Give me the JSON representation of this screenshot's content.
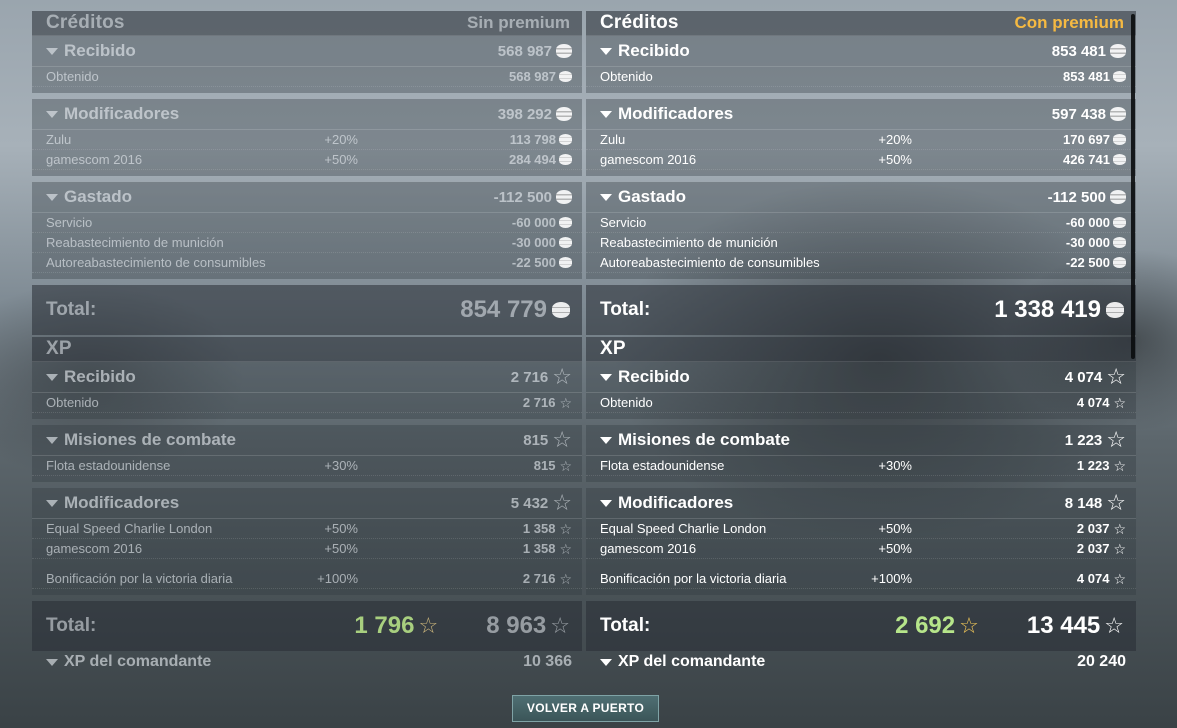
{
  "left": {
    "credits": {
      "title": "Créditos",
      "premium_label": "Sin premium",
      "received": {
        "label": "Recibido",
        "value": "568 987",
        "rows": [
          {
            "label": "Obtenido",
            "value": "568 987"
          }
        ]
      },
      "modifiers": {
        "label": "Modificadores",
        "value": "398 292",
        "rows": [
          {
            "label": "Zulu",
            "pct": "+20%",
            "value": "113 798"
          },
          {
            "label": "gamescom 2016",
            "pct": "+50%",
            "value": "284 494"
          }
        ]
      },
      "spent": {
        "label": "Gastado",
        "value": "-112 500",
        "rows": [
          {
            "label": "Servicio",
            "value": "-60 000"
          },
          {
            "label": "Reabastecimiento de munición",
            "value": "-30 000"
          },
          {
            "label": "Autoreabastecimiento de consumibles",
            "value": "-22 500"
          }
        ]
      },
      "total_label": "Total:",
      "total": "854 779"
    },
    "xp": {
      "title": "XP",
      "received": {
        "label": "Recibido",
        "value": "2 716",
        "rows": [
          {
            "label": "Obtenido",
            "value": "2 716"
          }
        ]
      },
      "missions": {
        "label": "Misiones de combate",
        "value": "815",
        "rows": [
          {
            "label": "Flota estadounidense",
            "pct": "+30%",
            "value": "815"
          }
        ]
      },
      "modifiers": {
        "label": "Modificadores",
        "value": "5 432",
        "rows": [
          {
            "label": "Equal Speed Charlie London",
            "pct": "+50%",
            "value": "1 358"
          },
          {
            "label": "gamescom 2016",
            "pct": "+50%",
            "value": "1 358"
          }
        ],
        "bonus": {
          "label": "Bonificación por la victoria diaria",
          "pct": "+100%",
          "value": "2 716"
        }
      },
      "total_label": "Total:",
      "total_free": "1 796",
      "total": "8 963"
    },
    "cut": {
      "label": "XP del comandante",
      "value": "10 366"
    }
  },
  "right": {
    "credits": {
      "title": "Créditos",
      "premium_label": "Con premium",
      "received": {
        "label": "Recibido",
        "value": "853 481",
        "rows": [
          {
            "label": "Obtenido",
            "value": "853 481"
          }
        ]
      },
      "modifiers": {
        "label": "Modificadores",
        "value": "597 438",
        "rows": [
          {
            "label": "Zulu",
            "pct": "+20%",
            "value": "170 697"
          },
          {
            "label": "gamescom 2016",
            "pct": "+50%",
            "value": "426 741"
          }
        ]
      },
      "spent": {
        "label": "Gastado",
        "value": "-112 500",
        "rows": [
          {
            "label": "Servicio",
            "value": "-60 000"
          },
          {
            "label": "Reabastecimiento de munición",
            "value": "-30 000"
          },
          {
            "label": "Autoreabastecimiento de consumibles",
            "value": "-22 500"
          }
        ]
      },
      "total_label": "Total:",
      "total": "1 338 419"
    },
    "xp": {
      "title": "XP",
      "received": {
        "label": "Recibido",
        "value": "4 074",
        "rows": [
          {
            "label": "Obtenido",
            "value": "4 074"
          }
        ]
      },
      "missions": {
        "label": "Misiones de combate",
        "value": "1 223",
        "rows": [
          {
            "label": "Flota estadounidense",
            "pct": "+30%",
            "value": "1 223"
          }
        ]
      },
      "modifiers": {
        "label": "Modificadores",
        "value": "8 148",
        "rows": [
          {
            "label": "Equal Speed Charlie London",
            "pct": "+50%",
            "value": "2 037"
          },
          {
            "label": "gamescom 2016",
            "pct": "+50%",
            "value": "2 037"
          }
        ],
        "bonus": {
          "label": "Bonificación por la victoria diaria",
          "pct": "+100%",
          "value": "4 074"
        }
      },
      "total_label": "Total:",
      "total_free": "2 692",
      "total": "13 445"
    },
    "cut": {
      "label": "XP del comandante",
      "value": "20 240"
    }
  },
  "footer": {
    "back_button": "VOLVER A PUERTO"
  },
  "colors": {
    "premium_accent": "#f5b942",
    "free_xp_green": "#b6e58a",
    "star_gold": "#f1c758"
  }
}
